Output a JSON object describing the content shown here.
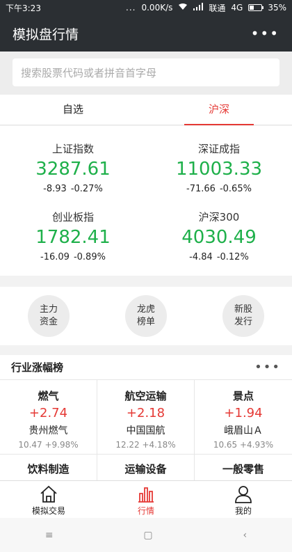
{
  "status_bar": {
    "time": "下午3:23",
    "dots": "...",
    "speed": "0.00K/s",
    "carrier": "联通",
    "network": "4G",
    "battery": "35%",
    "battery_level": 0.35
  },
  "header": {
    "title": "模拟盘行情",
    "more_icon": "•••"
  },
  "search": {
    "placeholder": "搜索股票代码或者拼音首字母"
  },
  "tabs": [
    {
      "label": "自选",
      "active": false
    },
    {
      "label": "沪深",
      "active": true
    }
  ],
  "indices": [
    {
      "name": "上证指数",
      "value": "3287.61",
      "change": "-8.93",
      "pct": "-0.27%"
    },
    {
      "name": "深证成指",
      "value": "11003.33",
      "change": "-71.66",
      "pct": "-0.65%"
    },
    {
      "name": "创业板指",
      "value": "1782.41",
      "change": "-16.09",
      "pct": "-0.89%"
    },
    {
      "name": "沪深300",
      "value": "4030.49",
      "change": "-4.84",
      "pct": "-0.12%"
    }
  ],
  "quick_links": [
    {
      "line1": "主力",
      "line2": "资金"
    },
    {
      "line1": "龙虎",
      "line2": "榜单"
    },
    {
      "line1": "新股",
      "line2": "发行"
    }
  ],
  "industry": {
    "title": "行业涨幅榜",
    "more_icon": "•••",
    "items": [
      {
        "industry": "燃气",
        "change": "+2.74",
        "stock": "贵州燃气",
        "sub": "10.47 +9.98%"
      },
      {
        "industry": "航空运输",
        "change": "+2.18",
        "stock": "中国国航",
        "sub": "12.22 +4.18%"
      },
      {
        "industry": "景点",
        "change": "+1.94",
        "stock": "峨眉山Ａ",
        "sub": "10.65 +4.93%"
      },
      {
        "industry": "饮料制造"
      },
      {
        "industry": "运输设备"
      },
      {
        "industry": "一般零售"
      }
    ]
  },
  "bottom_nav": [
    {
      "label": "模拟交易",
      "icon": "home-icon",
      "active": false
    },
    {
      "label": "行情",
      "icon": "bar-chart-icon",
      "active": true
    },
    {
      "label": "我的",
      "icon": "user-icon",
      "active": false
    }
  ],
  "system_nav": {
    "menu": "≡",
    "home": "▢",
    "back": "‹"
  },
  "colors": {
    "header_bg": "#2b2f33",
    "accent_red": "#e53935",
    "index_green": "#1eb04a"
  }
}
